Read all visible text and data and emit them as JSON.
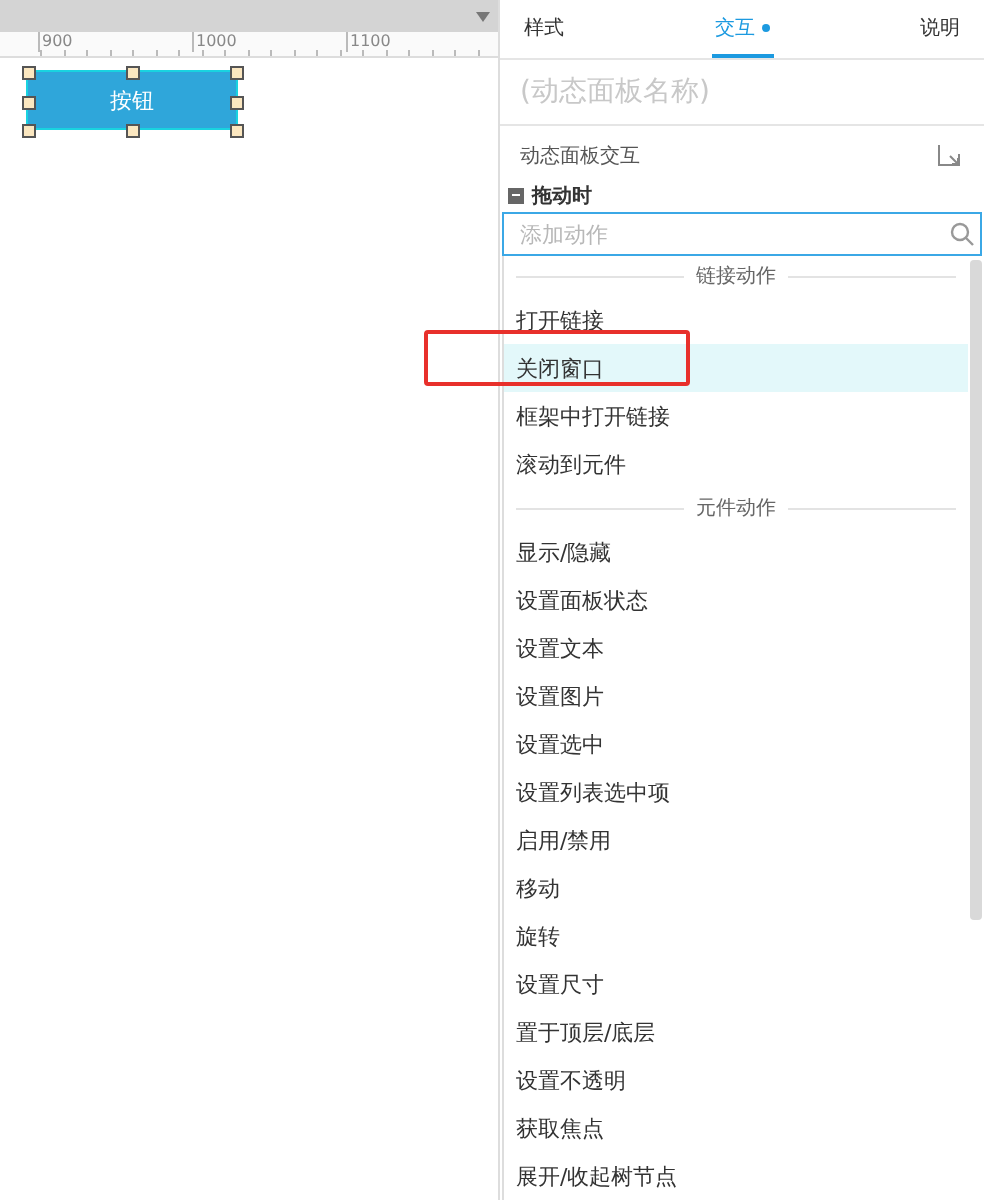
{
  "canvas": {
    "ruler_ticks": [
      "900",
      "1000",
      "1100"
    ],
    "button": {
      "label": "按钮",
      "selected": true
    }
  },
  "panel": {
    "tabs": [
      {
        "label": "样式",
        "selected": false,
        "dot": false
      },
      {
        "label": "交互",
        "selected": true,
        "dot": true
      },
      {
        "label": "说明",
        "selected": false,
        "dot": false
      }
    ],
    "name_placeholder": "(动态面板名称)",
    "section_title": "动态面板交互",
    "event": {
      "label": "拖动时",
      "expanded": true
    },
    "search": {
      "placeholder": "添加动作"
    },
    "groups": [
      {
        "title": "链接动作",
        "items": [
          {
            "label": "打开链接",
            "selected": false
          },
          {
            "label": "关闭窗口",
            "selected": true,
            "highlighted": true
          },
          {
            "label": "框架中打开链接",
            "selected": false
          },
          {
            "label": "滚动到元件",
            "selected": false
          }
        ]
      },
      {
        "title": "元件动作",
        "items": [
          {
            "label": "显示/隐藏",
            "selected": false
          },
          {
            "label": "设置面板状态",
            "selected": false
          },
          {
            "label": "设置文本",
            "selected": false
          },
          {
            "label": "设置图片",
            "selected": false
          },
          {
            "label": "设置选中",
            "selected": false
          },
          {
            "label": "设置列表选中项",
            "selected": false
          },
          {
            "label": "启用/禁用",
            "selected": false
          },
          {
            "label": "移动",
            "selected": false
          },
          {
            "label": "旋转",
            "selected": false
          },
          {
            "label": "设置尺寸",
            "selected": false
          },
          {
            "label": "置于顶层/底层",
            "selected": false
          },
          {
            "label": "设置不透明",
            "selected": false
          },
          {
            "label": "获取焦点",
            "selected": false
          },
          {
            "label": "展开/收起树节点",
            "selected": false
          }
        ]
      }
    ]
  }
}
